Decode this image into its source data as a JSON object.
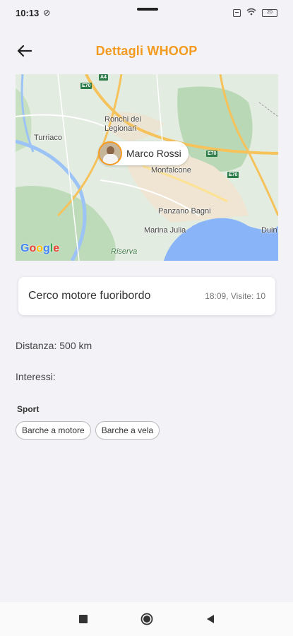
{
  "status_bar": {
    "time": "10:13",
    "battery": "20"
  },
  "header": {
    "title": "Dettagli WHOOP"
  },
  "map": {
    "labels": {
      "ronchi": "Ronchi dei\nLegionari",
      "turriaco": "Turriaco",
      "monfalcone": "Monfalcone",
      "panzano": "Panzano Bagni",
      "marina": "Marina Julia",
      "riserva": "Riserva",
      "duino": "Duin"
    },
    "road_badges": {
      "e70_top": "E70",
      "e70_right": "E70",
      "e70_lower": "E70",
      "a4": "A4"
    },
    "pin_name": "Marco Rossi",
    "attribution": [
      "G",
      "o",
      "o",
      "g",
      "l",
      "e"
    ]
  },
  "post": {
    "title": "Cerco motore fuoribordo",
    "meta": "18:09, Visite: 10"
  },
  "details": {
    "distance": "Distanza: 500 km",
    "interests_label": "Interessi:"
  },
  "interests": {
    "category": "Sport",
    "chips": [
      "Barche a motore",
      "Barche a vela"
    ]
  },
  "colors": {
    "accent": "#f39a1f",
    "background": "#f2f2f7"
  }
}
